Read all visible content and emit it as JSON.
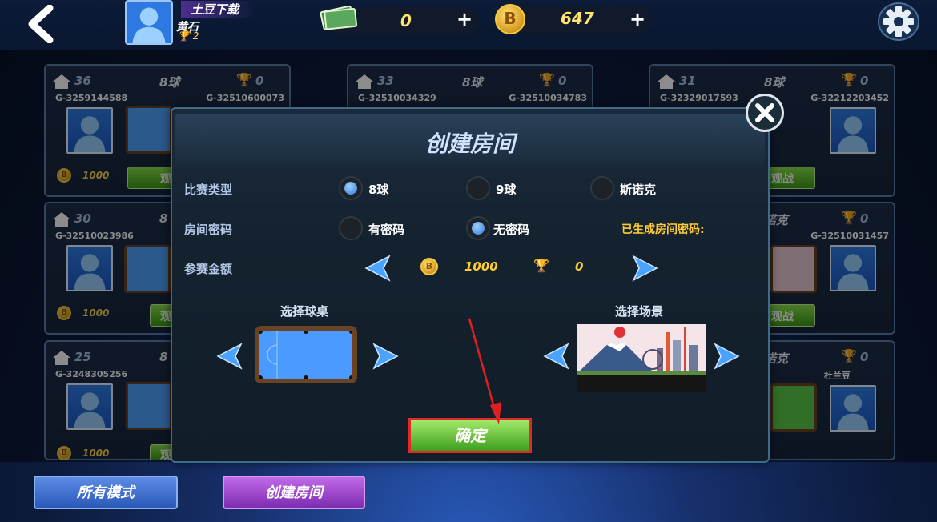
{
  "header": {
    "username": "土豆下载",
    "rank": "黄石",
    "trophies": "2",
    "cash": "0",
    "coins": "647",
    "plus": "+"
  },
  "rooms": [
    {
      "num": "36",
      "mode": "8球",
      "trophy": "0",
      "id1": "G-3259144588",
      "id2": "G-32510600073",
      "bet": "1000",
      "action": "观"
    },
    {
      "num": "33",
      "mode": "8球",
      "trophy": "0",
      "id1": "G-32510034329",
      "id2": "G-32510034783",
      "bet": "",
      "action": ""
    },
    {
      "num": "31",
      "mode": "8球",
      "trophy": "0",
      "id1": "G-32329017593",
      "id2": "G-32212203452",
      "bet": "",
      "action": "观战"
    },
    {
      "num": "30",
      "mode": "8",
      "trophy": "",
      "id1": "G-32510023986",
      "id2": "",
      "bet": "1000",
      "action": "观"
    },
    {
      "num": "",
      "mode": "诺克",
      "trophy": "0",
      "id1": "",
      "id2": "G-32510031457",
      "bet": "",
      "action": "观战"
    },
    {
      "num": "25",
      "mode": "8",
      "trophy": "",
      "id1": "G-3248305256",
      "id2": "",
      "bet": "1000",
      "action": "观"
    },
    {
      "num": "",
      "mode": "诺克",
      "trophy": "0",
      "id1": "",
      "id2": "杜兰豆",
      "bet": "",
      "action": ""
    }
  ],
  "dialog": {
    "title": "创建房间",
    "match_type_label": "比赛类型",
    "match_types": [
      "8球",
      "9球",
      "斯诺克"
    ],
    "selected_match_type": "8球",
    "password_label": "房间密码",
    "password_options": [
      "有密码",
      "无密码"
    ],
    "selected_password": "无密码",
    "generated_password_note": "已生成房间密码:",
    "fee_label": "参赛金额",
    "fee_value": "1000",
    "fee_trophy": "0",
    "table_label": "选择球桌",
    "scene_label": "选择场景",
    "confirm": "确定"
  },
  "bottom": {
    "all_modes": "所有模式",
    "create_room": "创建房间"
  },
  "colors": {
    "accent_green": "#5cc232",
    "highlight_red": "#e02a2a",
    "coin_gold": "#f6c93e"
  }
}
